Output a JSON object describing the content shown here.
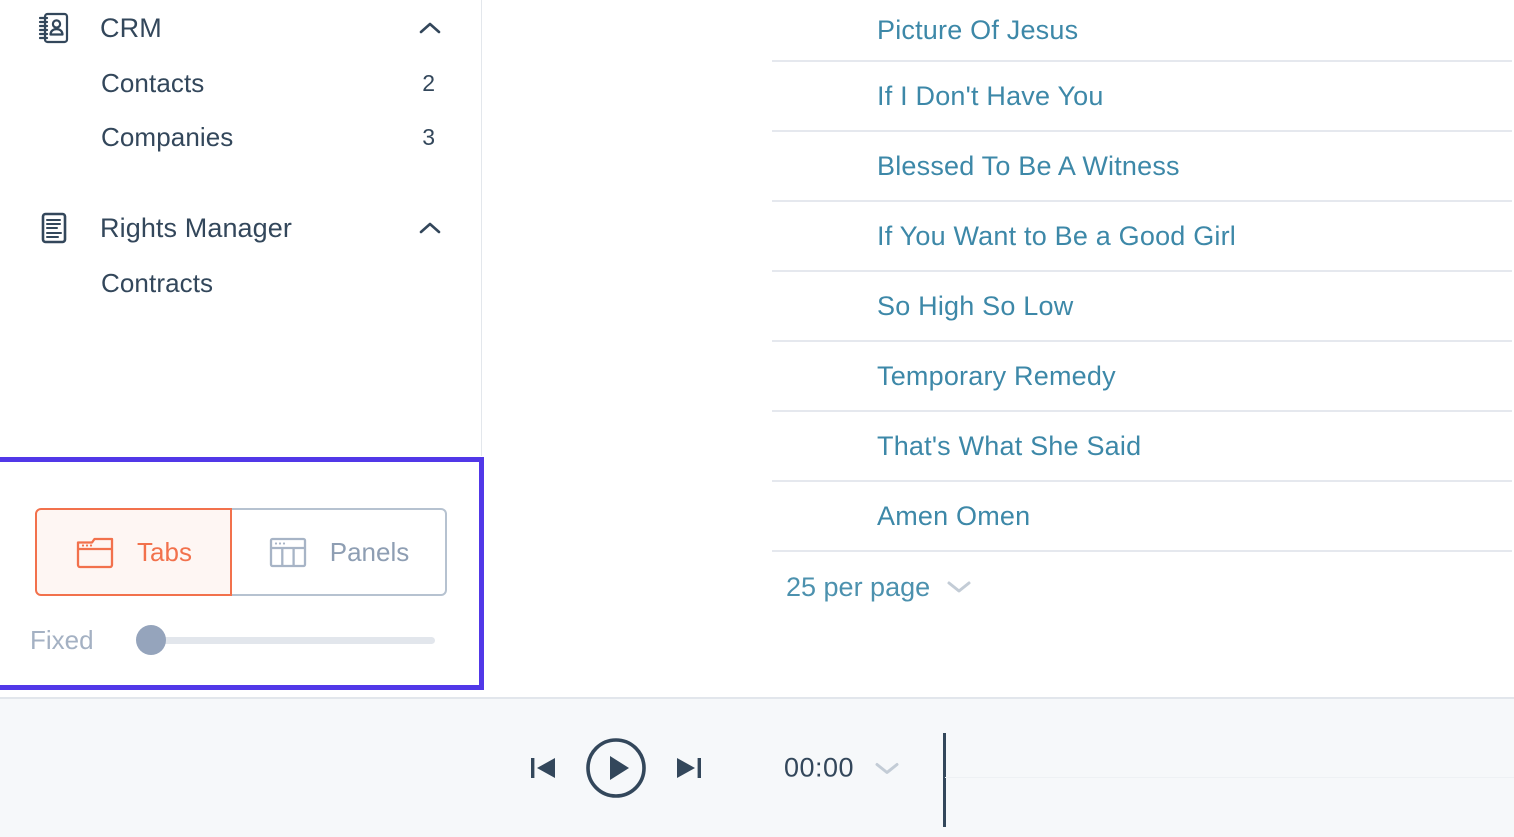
{
  "sidebar": {
    "groups": [
      {
        "title": "CRM",
        "icon": "address-book-icon",
        "expanded_icon": "chevron-up-icon",
        "items": [
          {
            "label": "Contacts",
            "count": "2"
          },
          {
            "label": "Companies",
            "count": "3"
          }
        ]
      },
      {
        "title": "Rights Manager",
        "icon": "document-lines-icon",
        "expanded_icon": "chevron-up-icon",
        "items": [
          {
            "label": "Contracts",
            "count": ""
          }
        ]
      }
    ]
  },
  "layout_control": {
    "highlight_color": "#5138E8",
    "selected": "Tabs",
    "options": [
      {
        "label": "Tabs",
        "icon": "browser-tab-icon",
        "selected": true,
        "color": "#F2714C"
      },
      {
        "label": "Panels",
        "icon": "columns-panel-icon",
        "selected": false,
        "color": "#8E9EB3"
      }
    ],
    "slider": {
      "label": "Fixed",
      "value": 0,
      "min": 0,
      "max": 100
    }
  },
  "list": {
    "link_color": "#3D88A8",
    "songs": [
      {
        "title": "Picture Of Jesus"
      },
      {
        "title": "If I Don't Have You"
      },
      {
        "title": "Blessed To Be A Witness"
      },
      {
        "title": "If You Want to Be a Good Girl"
      },
      {
        "title": "So High So Low"
      },
      {
        "title": "Temporary Remedy"
      },
      {
        "title": "That's What She Said"
      },
      {
        "title": "Amen Omen"
      }
    ],
    "per_page": {
      "label": "25 per page",
      "icon": "chevron-down-icon"
    }
  },
  "player": {
    "previous_icon": "skip-previous-icon",
    "play_icon": "play-circle-icon",
    "next_icon": "skip-next-icon",
    "time": "00:00",
    "time_dropdown_icon": "chevron-down-icon"
  }
}
